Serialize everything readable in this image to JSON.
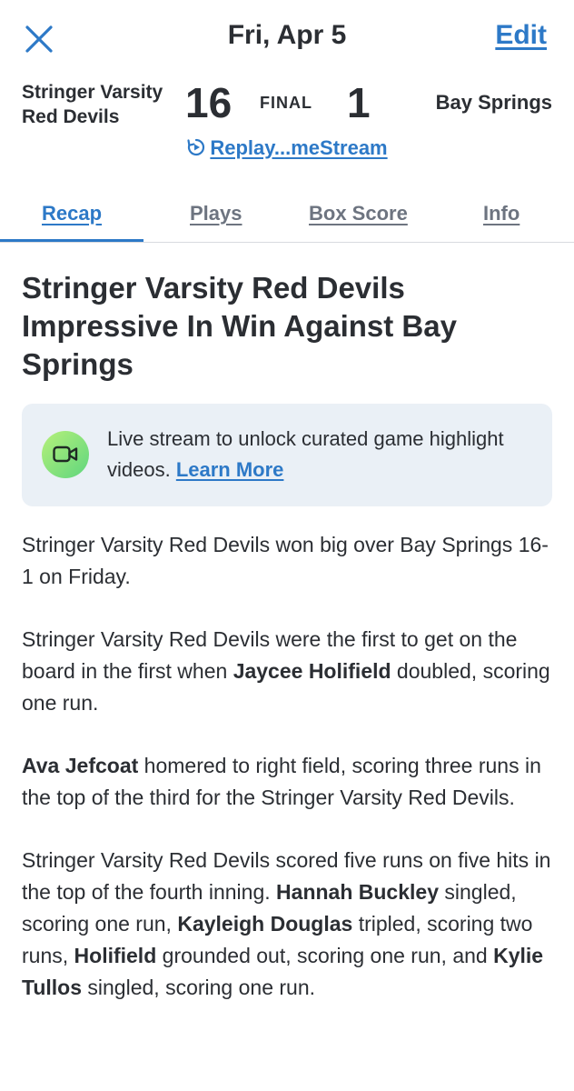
{
  "header": {
    "date": "Fri, Apr 5",
    "edit_label": "Edit"
  },
  "game": {
    "home_team": "Stringer Varsity Red Devils",
    "home_score": "16",
    "status": "FINAL",
    "away_score": "1",
    "away_team": "Bay Springs",
    "replay_label": "Replay...meStream"
  },
  "tabs": [
    {
      "label": "Recap",
      "active": true
    },
    {
      "label": "Plays",
      "active": false
    },
    {
      "label": "Box Score",
      "active": false
    },
    {
      "label": "Info",
      "active": false
    }
  ],
  "recap": {
    "headline": "Stringer Varsity Red Devils Impressive In Win Against Bay Springs",
    "banner_text": "Live stream to unlock curated game highlight videos. ",
    "banner_link": "Learn More",
    "p1": "Stringer Varsity Red Devils won big over Bay Springs 16-1 on Friday.",
    "p2_a": "Stringer Varsity Red Devils were the first to get on the board in the first when ",
    "p2_b": "Jaycee Holifield",
    "p2_c": " doubled, scoring one run.",
    "p3_a": "Ava Jefcoat",
    "p3_b": " homered to right field, scoring three runs in the top of the third for the Stringer Varsity Red Devils.",
    "p4_a": "Stringer Varsity Red Devils scored five runs on five hits in the top of the fourth inning. ",
    "p4_b": "Hannah Buckley",
    "p4_c": " singled, scoring one run, ",
    "p4_d": "Kayleigh Douglas",
    "p4_e": " tripled, scoring two runs, ",
    "p4_f": "Holifield",
    "p4_g": " grounded out, scoring one run, and ",
    "p4_h": "Kylie Tullos",
    "p4_i": " singled, scoring one run."
  },
  "icons": {
    "close": "close-icon",
    "replay": "replay-icon",
    "video": "video-camera-icon"
  },
  "colors": {
    "accent": "#2d79c7",
    "text": "#2b2e33",
    "muted_tab": "#6d7480",
    "banner_bg": "#eaf0f6"
  }
}
